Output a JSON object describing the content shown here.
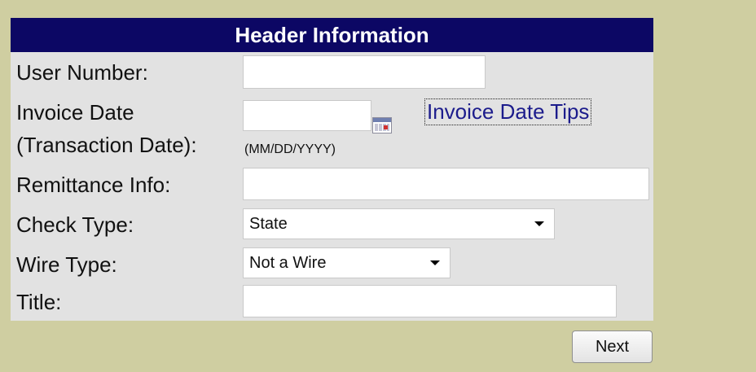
{
  "header": {
    "title": "Header Information"
  },
  "form": {
    "user_number": {
      "label": "User Number:",
      "value": ""
    },
    "invoice_date": {
      "label_line1": "Invoice Date",
      "label_line2": "(Transaction Date):",
      "value": "",
      "format_hint": "(MM/DD/YYYY)",
      "tips_link": "Invoice Date Tips"
    },
    "remittance_info": {
      "label": "Remittance Info:",
      "value": ""
    },
    "check_type": {
      "label": "Check Type:",
      "selected": "State"
    },
    "wire_type": {
      "label": "Wire Type:",
      "selected": "Not a Wire"
    },
    "title": {
      "label": "Title:",
      "value": ""
    }
  },
  "actions": {
    "next_label": "Next"
  },
  "colors": {
    "page_background": "#cfcea1",
    "panel_background": "#e2e2e2",
    "header_background": "#0c0764",
    "link": "#1c1c8c"
  },
  "icons": {
    "date_picker": "calendar-icon",
    "dropdown": "dropdown-arrow-icon"
  }
}
